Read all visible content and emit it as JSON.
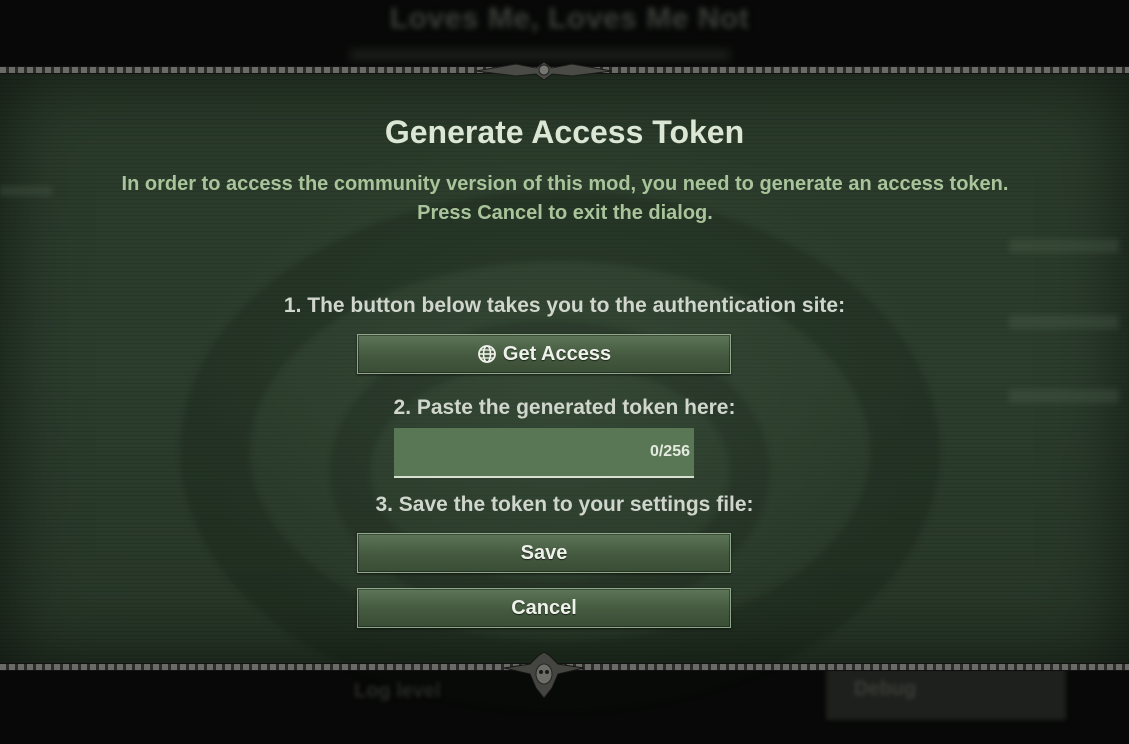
{
  "background": {
    "title": "Loves Me, Loves Me Not",
    "log_level_label": "Log level",
    "debug_label": "Debug"
  },
  "dialog": {
    "title": "Generate Access Token",
    "description": "In order to access the community version of this mod, you need to generate an access token.",
    "cancel_hint": "Press Cancel to exit the dialog.",
    "step1": "1. The button below takes you to the authentication site:",
    "get_access_label": "Get Access",
    "get_access_icon": "globe-icon",
    "step2": "2. Paste the generated token here:",
    "token_input": {
      "value": "",
      "placeholder": "",
      "counter": "0/256"
    },
    "step3": "3. Save the token to your settings file:",
    "save_label": "Save",
    "cancel_label": "Cancel"
  },
  "colors": {
    "panel": "#2c3d2d",
    "button": "#4a6145",
    "title_text": "#dce6d4",
    "description_text": "#a9c49a"
  }
}
